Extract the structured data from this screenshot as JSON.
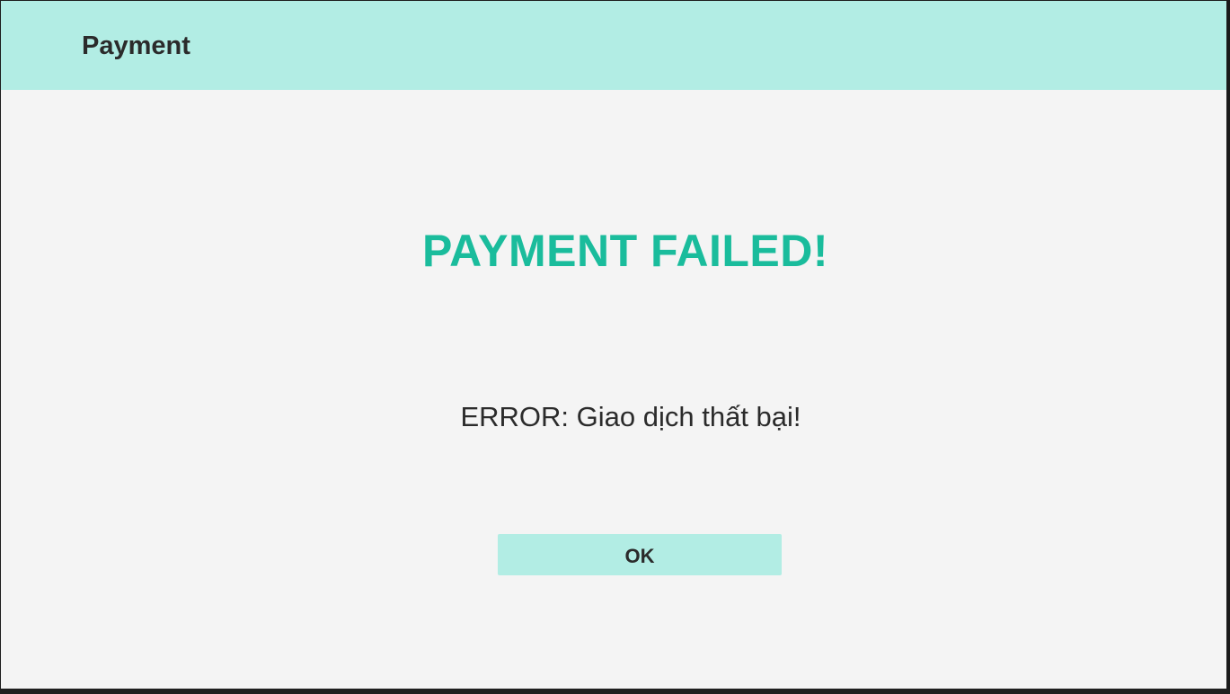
{
  "window": {
    "header_title": "Payment"
  },
  "main": {
    "status_title": "PAYMENT FAILED!",
    "error_message": "ERROR: Giao dịch thất bại!",
    "ok_label": "OK"
  },
  "colors": {
    "accent_bg": "#b2ede4",
    "status_text": "#1abc9c",
    "body_bg": "#f4f4f4",
    "text": "#2b2b2b"
  }
}
